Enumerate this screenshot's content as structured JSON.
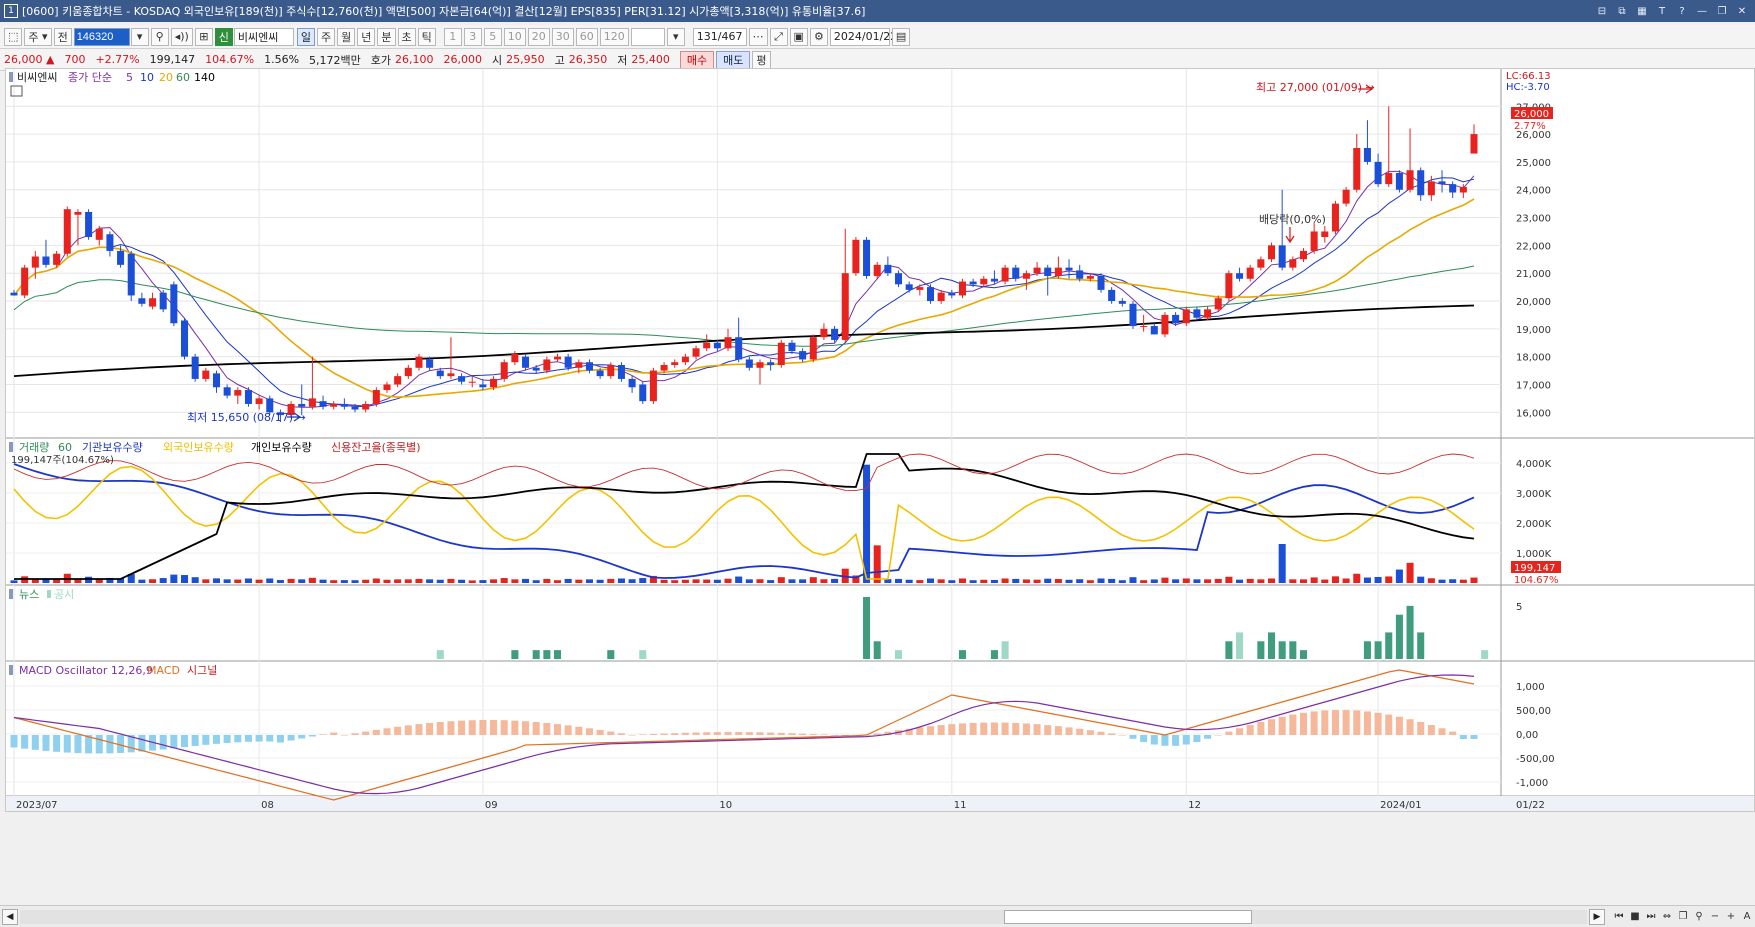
{
  "window": {
    "title": "[0600] 키움종합차트 - KOSDAQ 외국인보유[189(천)] 주식수[12,760(천)] 액면[500] 자본금[64(억)] 결산[12월] EPS[835] PER[31.12] 시가총액[3,318(억)] 유통비율[37.6]",
    "icon_label": "1"
  },
  "toolbar": {
    "period_type": "주",
    "prev_label": "전",
    "stock_code": "146320",
    "stock_tag": "신",
    "stock_name": "비씨엔씨",
    "periods": [
      "일",
      "주",
      "월",
      "년",
      "분",
      "초",
      "틱"
    ],
    "active_period": "일",
    "intervals": [
      "1",
      "3",
      "5",
      "10",
      "20",
      "30",
      "60",
      "120"
    ],
    "page_counter": "131/467",
    "date": "2024/01/22"
  },
  "quote": {
    "price": "26,000",
    "change_arrow": "▲",
    "change": "700",
    "change_pct": "+2.77%",
    "volume": "199,147",
    "volume_ratio": "104.67%",
    "turnover": "1.56%",
    "amount": "5,172백만",
    "hoga_label": "호가",
    "ask": "26,100",
    "bid": "26,000",
    "open_label": "시",
    "open": "25,950",
    "high_label": "고",
    "high": "26,350",
    "low_label": "저",
    "low": "25,400",
    "buy_label": "매수",
    "sell_label": "매도",
    "avg_label": "평"
  },
  "chart_data": {
    "type": "candlestick",
    "x_labels": [
      "2023/07",
      "08",
      "09",
      "10",
      "11",
      "12",
      "2024/01",
      "01/22"
    ],
    "price_axis": [
      "27,000",
      "26,000",
      "25,000",
      "24,000",
      "23,000",
      "22,000",
      "21,000",
      "20,000",
      "19,000",
      "18,000",
      "17,000",
      "16,000"
    ],
    "ylim": [
      15400,
      27800
    ],
    "price_legend": {
      "stock": "비씨엔씨",
      "ma_label": "종가 단순",
      "ma_periods": [
        "5",
        "10",
        "20",
        "60",
        "140"
      ],
      "ma_colors": [
        "#7b2fa6",
        "#1b36c8",
        "#e8a800",
        "#2e8b57",
        "#000000"
      ]
    },
    "lc_label": "LC:66.13",
    "hc_label": "HC:-3.70",
    "current_price_tag": "26,000",
    "current_pct_tag": "2.77%",
    "max_note": "최고 27,000 (01/09) →",
    "min_note": "최저 15,650 (08/17) →",
    "dividend_note": "배당락(0,0%)",
    "candles": [
      [
        20300,
        20200,
        20400,
        20250
      ],
      [
        20200,
        21200,
        21300,
        20100
      ],
      [
        21200,
        21600,
        21800,
        20800
      ],
      [
        21600,
        21300,
        22200,
        21200
      ],
      [
        21300,
        21700,
        21800,
        21200
      ],
      [
        21700,
        23300,
        23400,
        21600
      ],
      [
        23100,
        23200,
        23300,
        22000
      ],
      [
        23200,
        22300,
        23300,
        22200
      ],
      [
        22200,
        22600,
        22700,
        22000
      ],
      [
        22400,
        21800,
        22500,
        21600
      ],
      [
        21800,
        21300,
        22000,
        21200
      ],
      [
        21700,
        20200,
        21800,
        20000
      ],
      [
        20100,
        19900,
        20300,
        19800
      ],
      [
        19800,
        20100,
        20300,
        19700
      ],
      [
        20300,
        19700,
        20400,
        19600
      ],
      [
        20600,
        19200,
        20700,
        19100
      ],
      [
        19300,
        18000,
        19400,
        17900
      ],
      [
        18000,
        17200,
        18100,
        17100
      ],
      [
        17200,
        17500,
        17600,
        17100
      ],
      [
        17400,
        16900,
        17500,
        16700
      ],
      [
        16900,
        16600,
        17000,
        16500
      ],
      [
        16600,
        16800,
        16900,
        16300
      ],
      [
        16800,
        16300,
        16900,
        16200
      ],
      [
        16300,
        16500,
        16600,
        16100
      ],
      [
        16500,
        16000,
        16600,
        15900
      ],
      [
        16000,
        15900,
        16100,
        15650
      ],
      [
        15900,
        16300,
        16400,
        15800
      ],
      [
        16300,
        16200,
        17000,
        15900
      ],
      [
        16200,
        16500,
        18000,
        16100
      ],
      [
        16400,
        16200,
        16600,
        16100
      ],
      [
        16200,
        16300,
        16400,
        16100
      ],
      [
        16300,
        16200,
        16500,
        16100
      ],
      [
        16200,
        16100,
        16300,
        16000
      ],
      [
        16100,
        16300,
        16400,
        16000
      ],
      [
        16300,
        16800,
        16900,
        16200
      ],
      [
        16800,
        17000,
        17100,
        16700
      ],
      [
        17000,
        17300,
        17400,
        16900
      ],
      [
        17300,
        17600,
        17700,
        17200
      ],
      [
        17600,
        18000,
        18100,
        17500
      ],
      [
        17900,
        17600,
        18000,
        17500
      ],
      [
        17500,
        17300,
        17600,
        17200
      ],
      [
        17300,
        17400,
        18700,
        17200
      ],
      [
        17300,
        17100,
        17400,
        17000
      ],
      [
        17100,
        17100,
        17300,
        16900
      ],
      [
        17000,
        16900,
        17200,
        16800
      ],
      [
        16900,
        17200,
        17300,
        16800
      ],
      [
        17200,
        17800,
        17900,
        17100
      ],
      [
        17800,
        18100,
        18200,
        17700
      ],
      [
        18000,
        17600,
        18100,
        17500
      ],
      [
        17600,
        17500,
        17700,
        17400
      ],
      [
        17500,
        17900,
        18000,
        17400
      ],
      [
        17900,
        18000,
        18100,
        17800
      ],
      [
        18000,
        17600,
        18100,
        17500
      ],
      [
        17600,
        17800,
        17900,
        17400
      ],
      [
        17800,
        17500,
        17900,
        17400
      ],
      [
        17500,
        17300,
        17600,
        17200
      ],
      [
        17300,
        17700,
        17800,
        17200
      ],
      [
        17700,
        17200,
        17800,
        17100
      ],
      [
        17200,
        16900,
        17300,
        16700
      ],
      [
        17000,
        16400,
        17100,
        16300
      ],
      [
        16400,
        17500,
        17600,
        16300
      ],
      [
        17500,
        17700,
        17800,
        17400
      ],
      [
        17700,
        17800,
        17900,
        17600
      ],
      [
        17800,
        18000,
        18100,
        17700
      ],
      [
        18000,
        18300,
        18400,
        17900
      ],
      [
        18300,
        18500,
        18800,
        18200
      ],
      [
        18500,
        18300,
        18600,
        18200
      ],
      [
        18300,
        18700,
        19000,
        18200
      ],
      [
        18700,
        17900,
        19400,
        17800
      ],
      [
        17900,
        17600,
        18000,
        17500
      ],
      [
        17600,
        17800,
        17900,
        17000
      ],
      [
        17800,
        17700,
        17900,
        17500
      ],
      [
        17700,
        18500,
        18600,
        17600
      ],
      [
        18500,
        18200,
        18600,
        18100
      ],
      [
        18200,
        17900,
        18300,
        17800
      ],
      [
        17900,
        18700,
        18800,
        17800
      ],
      [
        18700,
        19000,
        19200,
        18600
      ],
      [
        19000,
        18600,
        19100,
        18500
      ],
      [
        18600,
        21000,
        22600,
        18500
      ],
      [
        21000,
        22200,
        22300,
        20900
      ],
      [
        22200,
        20900,
        22300,
        20800
      ],
      [
        20900,
        21300,
        21400,
        20800
      ],
      [
        21300,
        21000,
        21600,
        20900
      ],
      [
        21000,
        20600,
        21100,
        20500
      ],
      [
        20600,
        20400,
        20700,
        20300
      ],
      [
        20400,
        20500,
        20600,
        20200
      ],
      [
        20500,
        20000,
        20600,
        19900
      ],
      [
        20000,
        20300,
        20400,
        19900
      ],
      [
        20300,
        20200,
        20400,
        20100
      ],
      [
        20200,
        20700,
        20800,
        20100
      ],
      [
        20700,
        20600,
        20800,
        20500
      ],
      [
        20600,
        20800,
        20900,
        20500
      ],
      [
        20800,
        20700,
        21100,
        20600
      ],
      [
        20700,
        21200,
        21300,
        20600
      ],
      [
        21200,
        20800,
        21300,
        20700
      ],
      [
        20800,
        21000,
        21100,
        20400
      ],
      [
        21000,
        21200,
        21400,
        20900
      ],
      [
        21200,
        20900,
        21300,
        20200
      ],
      [
        20900,
        21200,
        21600,
        20800
      ],
      [
        21200,
        21100,
        21500,
        20800
      ],
      [
        21100,
        20800,
        21300,
        20700
      ],
      [
        20800,
        20900,
        21000,
        20700
      ],
      [
        20900,
        20400,
        21000,
        20300
      ],
      [
        20400,
        20000,
        20500,
        19900
      ],
      [
        20000,
        19900,
        20100,
        19800
      ],
      [
        19900,
        19100,
        20000,
        19000
      ],
      [
        19100,
        19100,
        19500,
        18900
      ],
      [
        19100,
        18800,
        19200,
        18800
      ],
      [
        18800,
        19500,
        19600,
        18700
      ],
      [
        19500,
        19200,
        19600,
        19100
      ],
      [
        19200,
        19700,
        19800,
        19100
      ],
      [
        19700,
        19400,
        19800,
        19300
      ],
      [
        19400,
        19700,
        19800,
        19300
      ],
      [
        19700,
        20100,
        20200,
        19600
      ],
      [
        20100,
        21000,
        21100,
        20000
      ],
      [
        21000,
        20800,
        21200,
        20700
      ],
      [
        20800,
        21200,
        21300,
        20700
      ],
      [
        21200,
        21500,
        21600,
        21100
      ],
      [
        21500,
        22000,
        22100,
        21400
      ],
      [
        22000,
        21200,
        24000,
        21100
      ],
      [
        21200,
        21500,
        21600,
        21100
      ],
      [
        21500,
        21800,
        21900,
        21400
      ],
      [
        21800,
        22500,
        22800,
        21700
      ],
      [
        22300,
        22500,
        22700,
        22100
      ],
      [
        22500,
        23500,
        23600,
        22400
      ],
      [
        23500,
        24000,
        24100,
        23400
      ],
      [
        24000,
        25500,
        26000,
        23900
      ],
      [
        25500,
        25000,
        26500,
        24900
      ],
      [
        25000,
        24200,
        25300,
        24100
      ],
      [
        24200,
        24600,
        27000,
        24100
      ],
      [
        24600,
        24000,
        24700,
        23900
      ],
      [
        24000,
        24700,
        26200,
        23900
      ],
      [
        24700,
        23800,
        24800,
        23600
      ],
      [
        23800,
        24300,
        24500,
        23600
      ],
      [
        24300,
        24200,
        24700,
        23900
      ],
      [
        24200,
        23900,
        24300,
        23700
      ],
      [
        23900,
        24100,
        24200,
        23700
      ],
      [
        25300,
        26000,
        26350,
        25400
      ]
    ],
    "volume_legend": [
      "거래량",
      "60",
      "기관보유수량",
      "외국인보유수량",
      "개인보유수량",
      "신용잔고율(종목별)"
    ],
    "volume_readout": "199,147주(104.67%)",
    "volume_axis": [
      "4,000K",
      "3,000K",
      "2,000K",
      "1,000K"
    ],
    "volume_tag": "199,147",
    "volume_pct_tag": "104.67%",
    "news_legend": [
      "뉴스",
      "공시"
    ],
    "news_axis": [
      "5"
    ],
    "news_bars": [
      [
        40,
        1
      ],
      [
        47,
        1
      ],
      [
        49,
        1
      ],
      [
        50,
        1
      ],
      [
        51,
        1
      ],
      [
        56,
        1
      ],
      [
        59,
        1
      ],
      [
        80,
        7
      ],
      [
        81,
        2
      ],
      [
        83,
        1
      ],
      [
        89,
        1
      ],
      [
        92,
        1
      ],
      [
        93,
        2
      ],
      [
        114,
        2
      ],
      [
        115,
        3
      ],
      [
        117,
        2
      ],
      [
        118,
        3
      ],
      [
        119,
        2
      ],
      [
        120,
        2
      ],
      [
        121,
        1
      ],
      [
        127,
        2
      ],
      [
        128,
        2
      ],
      [
        129,
        3
      ],
      [
        130,
        5
      ],
      [
        131,
        6
      ],
      [
        132,
        3
      ],
      [
        138,
        1
      ]
    ],
    "macd_legend": [
      "MACD Oscillator 12,26,9",
      "MACD",
      "시그널"
    ],
    "macd_axis": [
      "1,000",
      "500,00",
      "0,00",
      "-500,00",
      "-1,000"
    ]
  },
  "colors": {
    "up": "#e8231e",
    "down": "#1c4fd8",
    "ma5": "#7b2fa6",
    "ma10": "#1b36c8",
    "ma20": "#e8a800",
    "ma60": "#2e8b57",
    "ma140": "#000000"
  }
}
